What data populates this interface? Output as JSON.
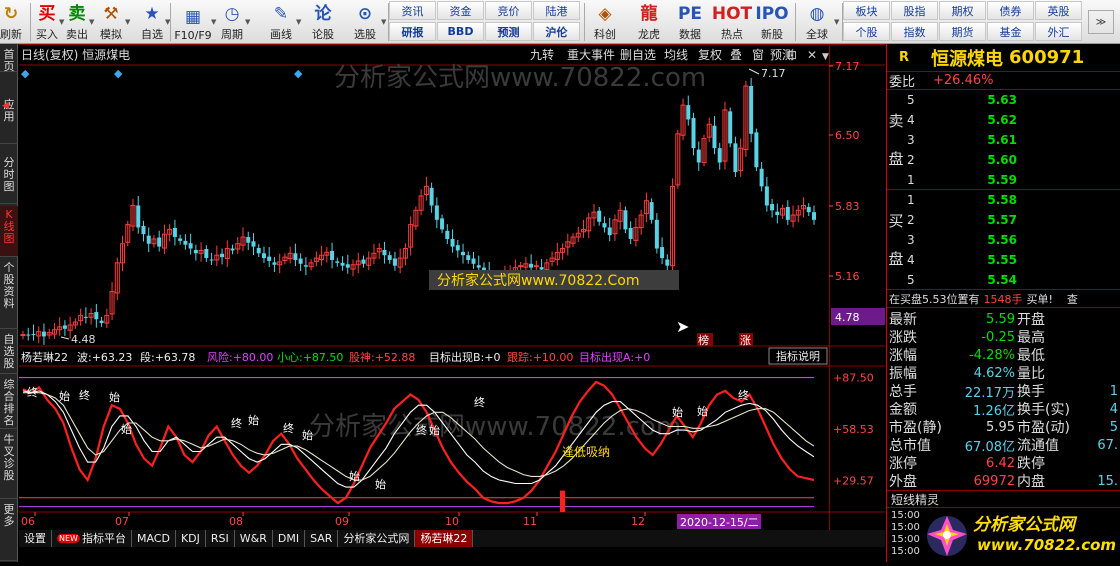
{
  "toolbar": {
    "items": [
      {
        "label": "刷新",
        "icon": "↻",
        "color": "#c08000",
        "name": "refresh"
      },
      {
        "label": "买入",
        "icon": "买",
        "color": "#e00000",
        "name": "buy"
      },
      {
        "label": "卖出",
        "icon": "卖",
        "color": "#008a00",
        "name": "sell"
      },
      {
        "label": "模拟",
        "icon": "⚒",
        "color": "#b05000",
        "name": "simulate"
      },
      {
        "label": "自选",
        "icon": "★",
        "color": "#2855b5",
        "name": "watchlist"
      },
      {
        "label": "F10/F9",
        "icon": "▦",
        "color": "#2855b5",
        "name": "f10"
      },
      {
        "label": "周期",
        "icon": "◷",
        "color": "#2855b5",
        "name": "period"
      },
      {
        "label": "画线",
        "icon": "✎",
        "color": "#2855b5",
        "name": "draw-line"
      },
      {
        "label": "论股",
        "icon": "论",
        "color": "#2855b5",
        "name": "discuss"
      },
      {
        "label": "选股",
        "icon": "⊙",
        "color": "#2855b5",
        "name": "stock-pick"
      },
      {
        "label": "科创",
        "icon": "◈",
        "color": "#b05000",
        "name": "star-market"
      },
      {
        "label": "龙虎",
        "icon": "龍",
        "color": "#d02020",
        "name": "dragon-tiger"
      },
      {
        "label": "数据",
        "icon": "PE",
        "color": "#2855b5",
        "name": "data"
      },
      {
        "label": "热点",
        "icon": "HOT",
        "color": "#d02020",
        "name": "hot"
      },
      {
        "label": "新股",
        "icon": "IPO",
        "color": "#2855b5",
        "name": "new-stock"
      },
      {
        "label": "全球",
        "icon": "◍",
        "color": "#2855b5",
        "name": "global"
      }
    ],
    "menu_left": [
      "资讯",
      "资金",
      "竞价",
      "陆港",
      "研报",
      "BBD",
      "预测",
      "沪伦"
    ],
    "menu_right": [
      "板块",
      "股指",
      "期权",
      "债券",
      "英股",
      "个股",
      "指数",
      "期货",
      "基金",
      "外汇"
    ]
  },
  "sidebar": [
    {
      "label": "首页",
      "active": false
    },
    {
      "label": "应用",
      "active": false
    },
    {
      "label": "分时图",
      "active": false
    },
    {
      "label": "K线图",
      "active": true
    },
    {
      "label": "个股资料",
      "active": false
    },
    {
      "label": "自选股",
      "active": false
    },
    {
      "label": "综合排名",
      "active": false
    },
    {
      "label": "牛叉诊股",
      "active": false
    },
    {
      "label": "更多",
      "active": false
    }
  ],
  "chart_header": {
    "title": "日线(复权) 恒源煤电",
    "buttons": [
      "九转",
      "重大事件",
      "删自选",
      "均线",
      "复权",
      "叠",
      "窗",
      "预测"
    ]
  },
  "chart_data": [
    {
      "type": "candlestick",
      "title": "日线(复权) 恒源煤电",
      "x_ticks": [
        "06",
        "07",
        "08",
        "09",
        "10",
        "11",
        "12"
      ],
      "y_ticks": [
        "7.17",
        "6.50",
        "5.83",
        "5.16",
        "4.48"
      ],
      "annotations": {
        "high": "7.17",
        "low": "4.48",
        "current_price": "4.78",
        "markers": [
          "榜",
          "涨"
        ],
        "watermark": "分析家公式网www.70822.com",
        "watermark_center": "分析家公式网www.70822.Com"
      },
      "closes": [
        4.5,
        4.49,
        4.5,
        4.53,
        4.48,
        4.52,
        4.55,
        4.58,
        4.56,
        4.6,
        4.63,
        4.7,
        4.68,
        4.72,
        4.66,
        4.62,
        4.7,
        4.95,
        5.25,
        5.45,
        5.65,
        5.85,
        5.62,
        5.55,
        5.45,
        5.5,
        5.42,
        5.55,
        5.6,
        5.52,
        5.48,
        5.44,
        5.4,
        5.35,
        5.38,
        5.3,
        5.28,
        5.33,
        5.31,
        5.4,
        5.38,
        5.45,
        5.52,
        5.46,
        5.42,
        5.35,
        5.3,
        5.27,
        5.23,
        5.26,
        5.31,
        5.35,
        5.28,
        5.24,
        5.21,
        5.25,
        5.3,
        5.33,
        5.36,
        5.28,
        5.25,
        5.22,
        5.2,
        5.23,
        5.27,
        5.24,
        5.3,
        5.35,
        5.4,
        5.33,
        5.28,
        5.22,
        5.3,
        5.4,
        5.65,
        5.8,
        5.95,
        6.05,
        5.85,
        5.7,
        5.6,
        5.5,
        5.42,
        5.38,
        5.33,
        5.28,
        5.24,
        5.2,
        5.16,
        5.1,
        5.03,
        5.07,
        5.12,
        5.17,
        5.2,
        5.22,
        5.24,
        5.2,
        5.22,
        5.18,
        5.25,
        5.3,
        5.36,
        5.4,
        5.47,
        5.52,
        5.56,
        5.6,
        5.72,
        5.78,
        5.68,
        5.62,
        5.54,
        5.7,
        5.8,
        5.6,
        5.5,
        5.62,
        5.75,
        5.9,
        5.7,
        5.4,
        5.3,
        5.22,
        6.05,
        6.6,
        6.9,
        6.75,
        6.45,
        6.3,
        6.55,
        6.7,
        6.45,
        6.3,
        6.85,
        6.5,
        6.2,
        6.45,
        7.1,
        6.6,
        6.25,
        6.05,
        5.85,
        5.8,
        5.75,
        5.82,
        5.7,
        5.75,
        5.8,
        5.85,
        5.78,
        5.7
      ],
      "last_candle_color": "#5ad2e6"
    },
    {
      "type": "line",
      "title": "杨若琳22",
      "y_ticks": [
        "+87.50",
        "+58.53",
        "+29.57"
      ],
      "legend": [
        {
          "name": "杨若琳22",
          "value": ""
        },
        {
          "name": "波",
          "value": "+63.23"
        },
        {
          "name": "段",
          "value": "+63.78"
        },
        {
          "name": "风险",
          "value": "+80.00"
        },
        {
          "name": "小心",
          "value": "+87.50"
        },
        {
          "name": "股神",
          "value": "+52.88"
        },
        {
          "name": "目标出现B",
          "value": "+0"
        },
        {
          "name": "跟踪",
          "value": "+10.00"
        },
        {
          "name": "目标出现A",
          "value": "+0"
        }
      ],
      "series": [
        {
          "name": "红线",
          "values": [
            81,
            79,
            82,
            75,
            70,
            62,
            48,
            36,
            30,
            42,
            60,
            72,
            70,
            62,
            50,
            42,
            38,
            48,
            60,
            54,
            44,
            40,
            46,
            55,
            60,
            52,
            44,
            38,
            34,
            38,
            44,
            52,
            56,
            50,
            42,
            36,
            30,
            25,
            21,
            17,
            20,
            28,
            38,
            48,
            55,
            62,
            70,
            74,
            78,
            75,
            68,
            58,
            48,
            40,
            34,
            29,
            25,
            20,
            18,
            17,
            17,
            18,
            20,
            24,
            30,
            38,
            46,
            56,
            66,
            74,
            80,
            85,
            83,
            78,
            70,
            62,
            54,
            48,
            44,
            50,
            58,
            66,
            60,
            54,
            62,
            72,
            78,
            80,
            76,
            74,
            78,
            70,
            60,
            50,
            42,
            36,
            32,
            31,
            30
          ]
        },
        {
          "name": "白线1",
          "values": [
            80,
            79,
            80,
            78,
            74,
            68,
            58,
            48,
            40,
            40,
            48,
            60,
            66,
            66,
            60,
            52,
            46,
            46,
            52,
            54,
            50,
            46,
            46,
            50,
            54,
            54,
            50,
            46,
            42,
            40,
            42,
            46,
            50,
            50,
            48,
            44,
            40,
            36,
            32,
            28,
            26,
            26,
            30,
            36,
            42,
            48,
            56,
            62,
            68,
            72,
            72,
            68,
            62,
            56,
            50,
            44,
            40,
            35,
            32,
            30,
            29,
            28,
            28,
            28,
            30,
            34,
            38,
            44,
            50,
            56,
            62,
            68,
            72,
            74,
            74,
            70,
            66,
            62,
            58,
            56,
            56,
            58,
            58,
            57,
            58,
            61,
            64,
            68,
            70,
            72,
            73,
            72,
            69,
            64,
            58,
            53,
            49,
            46,
            43
          ]
        },
        {
          "name": "白线2",
          "values": [
            79,
            79,
            79,
            78,
            76,
            72,
            64,
            56,
            48,
            44,
            46,
            52,
            58,
            62,
            62,
            58,
            54,
            52,
            52,
            53,
            52,
            50,
            48,
            49,
            51,
            53,
            52,
            50,
            47,
            45,
            44,
            45,
            47,
            49,
            49,
            47,
            44,
            41,
            38,
            35,
            32,
            30,
            30,
            32,
            36,
            40,
            45,
            51,
            57,
            62,
            66,
            68,
            68,
            65,
            61,
            57,
            53,
            48,
            44,
            40,
            37,
            35,
            33,
            32,
            32,
            33,
            35,
            38,
            42,
            47,
            52,
            57,
            62,
            66,
            69,
            70,
            69,
            67,
            64,
            62,
            60,
            60,
            60,
            59,
            59,
            60,
            61,
            63,
            65,
            67,
            69,
            70,
            70,
            68,
            64,
            60,
            56,
            52,
            49
          ]
        }
      ],
      "labels": [
        "终",
        "始",
        "终",
        "始",
        "始",
        "终",
        "始",
        "终",
        "始",
        "始",
        "终",
        "始",
        "逢低吸纳",
        "始",
        "终",
        "始",
        "始",
        "终"
      ],
      "button": "指标说明",
      "date_label": "2020-12-15/二"
    }
  ],
  "bottom_tabs": [
    "设置",
    "NEW",
    "指标平台",
    "MACD",
    "KDJ",
    "RSI",
    "W&R",
    "DMI",
    "SAR",
    "分析家公式网",
    "杨若琳22"
  ],
  "right": {
    "r_label": "R",
    "stock_name": "恒源煤电",
    "stock_code": "600971",
    "webi": {
      "label": "委比",
      "value": "+26.46%"
    },
    "sell_label": "卖盘",
    "buy_label": "买盘",
    "sell": [
      {
        "n": "5",
        "p": "5.63"
      },
      {
        "n": "4",
        "p": "5.62"
      },
      {
        "n": "3",
        "p": "5.61"
      },
      {
        "n": "2",
        "p": "5.60"
      },
      {
        "n": "1",
        "p": "5.59"
      }
    ],
    "buy": [
      {
        "n": "1",
        "p": "5.58"
      },
      {
        "n": "2",
        "p": "5.57"
      },
      {
        "n": "3",
        "p": "5.56"
      },
      {
        "n": "4",
        "p": "5.55"
      },
      {
        "n": "5",
        "p": "5.54"
      }
    ],
    "status": {
      "text": "在买盘5.53位置有",
      "qty": "1548手",
      "suffix": "买单!",
      "check": "查"
    },
    "stats": [
      {
        "k": "最新",
        "v": "5.59",
        "c": "#00dd00",
        "k2": "开盘",
        "v2": ""
      },
      {
        "k": "涨跌",
        "v": "-0.25",
        "c": "#00dd00",
        "k2": "最高",
        "v2": ""
      },
      {
        "k": "涨幅",
        "v": "-4.28%",
        "c": "#00dd00",
        "k2": "最低",
        "v2": ""
      },
      {
        "k": "振幅",
        "v": "4.62%",
        "c": "#5ad2e6",
        "k2": "量比",
        "v2": ""
      },
      {
        "k": "总手",
        "v": "22.17万",
        "c": "#5ad2e6",
        "k2": "换手",
        "v2": "1"
      },
      {
        "k": "金额",
        "v": "1.26亿",
        "c": "#5ad2e6",
        "k2": "换手(实)",
        "v2": "4"
      },
      {
        "k": "市盈(静)",
        "v": "5.95",
        "c": "#dddddd",
        "k2": "市盈(动)",
        "v2": "5"
      },
      {
        "k": "总市值",
        "v": "67.08亿",
        "c": "#5ad2e6",
        "k2": "流通值",
        "v2": "67."
      },
      {
        "k": "涨停",
        "v": "6.42",
        "c": "#ff4444",
        "k2": "跌停",
        "v2": ""
      },
      {
        "k": "外盘",
        "v": "69972",
        "c": "#ff4444",
        "k2": "内盘",
        "v2": "15."
      }
    ],
    "short_title": "短线精灵",
    "times": [
      "15:00",
      "15:00",
      "15:00",
      "15:00"
    ],
    "logo": {
      "text": "分析家公式网",
      "url": "www.70822.com"
    }
  }
}
